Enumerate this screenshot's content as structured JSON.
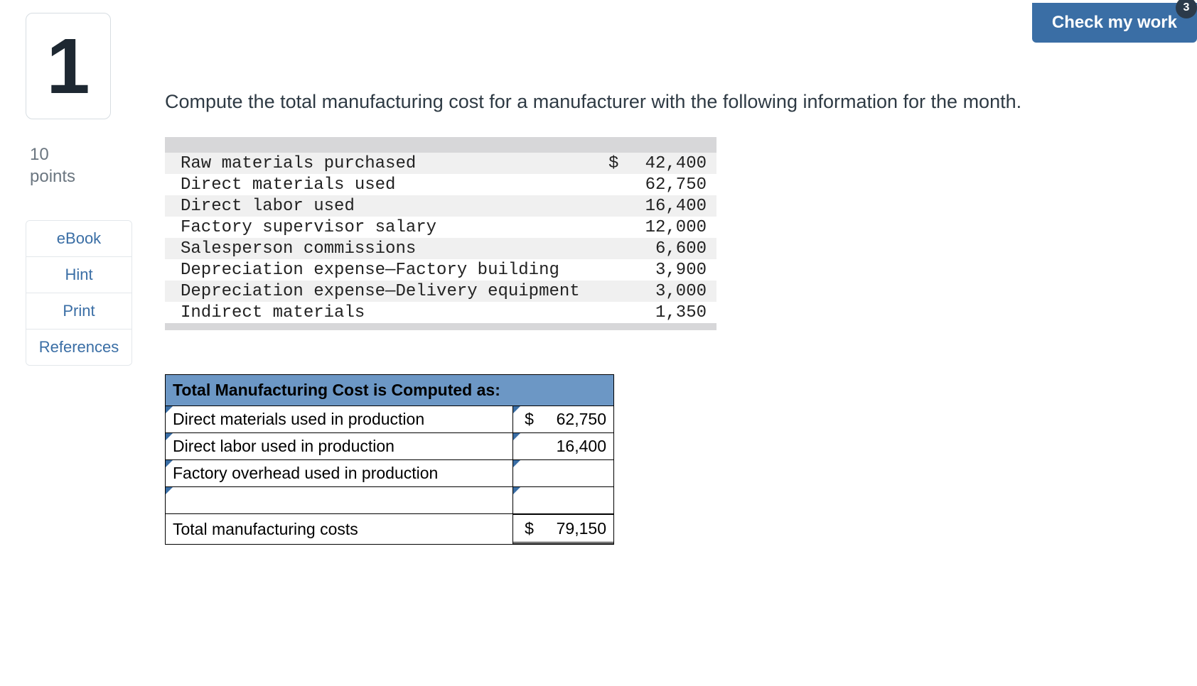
{
  "check_button": "Check my work",
  "check_badge": "3",
  "question_number": "1",
  "points_value": "10",
  "points_label": "points",
  "side_links": {
    "ebook": "eBook",
    "hint": "Hint",
    "print": "Print",
    "references": "References"
  },
  "prompt": "Compute the total manufacturing cost for a manufacturer with the following information for the month.",
  "info_rows": [
    {
      "label": "Raw materials purchased",
      "currency": "$",
      "value": "42,400"
    },
    {
      "label": "Direct materials used",
      "currency": "",
      "value": "62,750"
    },
    {
      "label": "Direct labor used",
      "currency": "",
      "value": "16,400"
    },
    {
      "label": "Factory supervisor salary",
      "currency": "",
      "value": "12,000"
    },
    {
      "label": "Salesperson commissions",
      "currency": "",
      "value": "6,600"
    },
    {
      "label": "Depreciation expense—Factory building",
      "currency": "",
      "value": "3,900"
    },
    {
      "label": "Depreciation expense—Delivery equipment",
      "currency": "",
      "value": "3,000"
    },
    {
      "label": "Indirect materials",
      "currency": "",
      "value": "1,350"
    }
  ],
  "answer": {
    "header": "Total Manufacturing Cost is Computed as:",
    "rows": [
      {
        "label": "Direct materials used in production",
        "currency": "$",
        "value": "62,750"
      },
      {
        "label": "Direct labor used in production",
        "currency": "",
        "value": "16,400"
      },
      {
        "label": "Factory overhead used in production",
        "currency": "",
        "value": ""
      },
      {
        "label": "",
        "currency": "",
        "value": ""
      }
    ],
    "total_label": "Total manufacturing costs",
    "total_currency": "$",
    "total_value": "79,150"
  }
}
